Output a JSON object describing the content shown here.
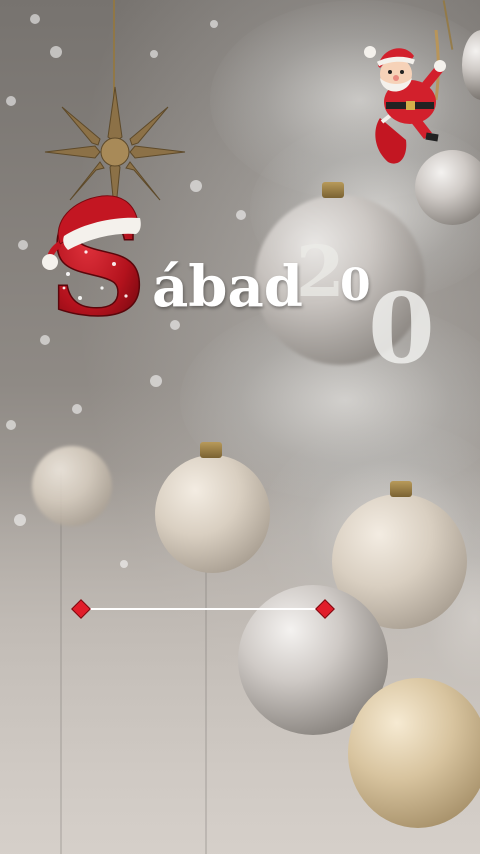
{
  "title": {
    "letter": "S",
    "rest": "ábad",
    "small_digit": "0",
    "digit_back": "2",
    "digit_front": "0"
  },
  "slider": {
    "start": 0,
    "end": 1
  },
  "colors": {
    "accent_red": "#e11d2a",
    "text": "#ffffff"
  },
  "icons": [
    "santa-claus-icon",
    "santa-hat-icon",
    "star-ornament-icon"
  ]
}
